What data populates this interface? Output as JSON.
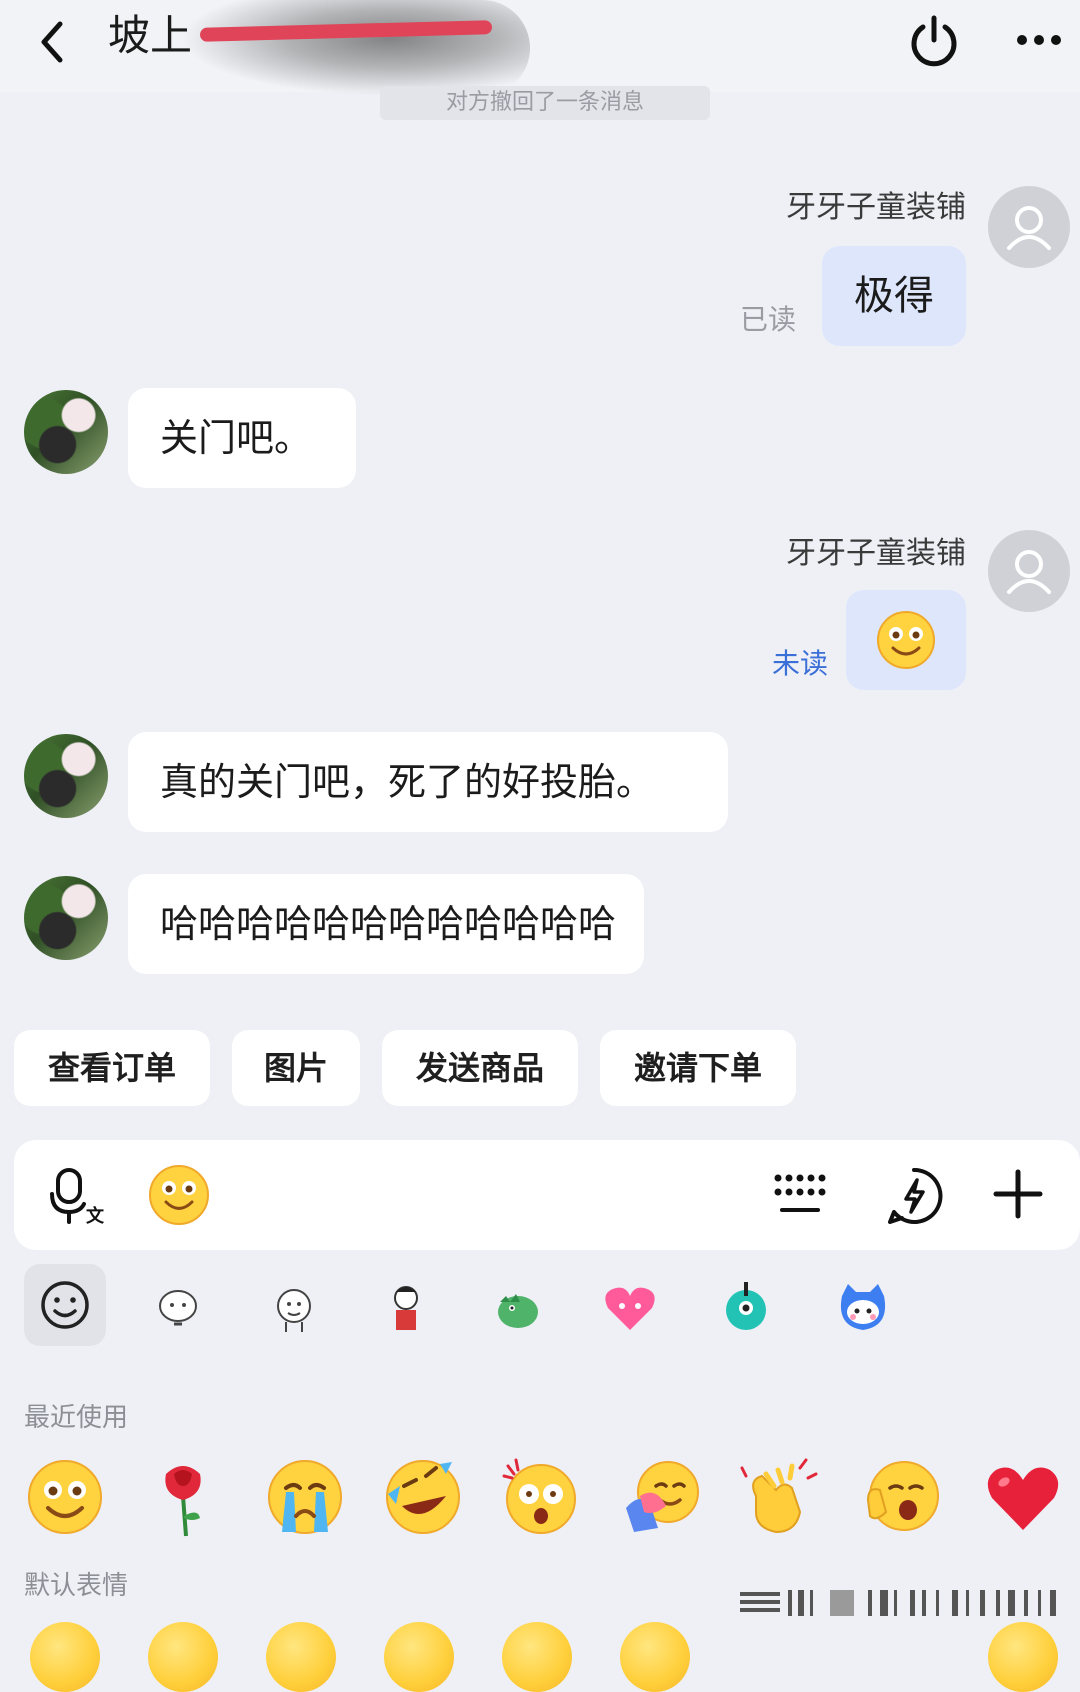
{
  "header": {
    "title": "坡上",
    "banner_text": "对方撤回了一条消息"
  },
  "messages": [
    {
      "sender": "牙牙子童装铺",
      "text": "极得",
      "status": "已读"
    },
    {
      "text": "关门吧。"
    },
    {
      "sender": "牙牙子童装铺",
      "emoji": "smiling-face-emoji",
      "status": "未读"
    },
    {
      "text": "真的关门吧，死了的好投胎。"
    },
    {
      "text": "哈哈哈哈哈哈哈哈哈哈哈哈"
    }
  ],
  "quick_actions": [
    "查看订单",
    "图片",
    "发送商品",
    "邀请下单"
  ],
  "input_bar": {
    "icons": [
      "voice-to-text-icon",
      "emoji-icon",
      "keyboard-icon",
      "quick-reply-icon",
      "plus-icon"
    ]
  },
  "emoji_tabs": [
    "smiley-tab-icon",
    "sticker-pack-1",
    "sticker-pack-2",
    "sticker-pack-3",
    "sticker-pack-4",
    "sticker-pack-5",
    "sticker-pack-6",
    "sticker-pack-7"
  ],
  "emoji_panel": {
    "recent_label": "最近使用",
    "default_label": "默认表情",
    "recent": [
      "smiling-face",
      "rose",
      "crying-face",
      "rolling-laughing-face",
      "shocked-face",
      "hugging-face",
      "clapping-hands",
      "yawning-face",
      "red-heart"
    ]
  },
  "colors": {
    "background": "#eef0f6",
    "outgoing_bubble": "#dde6fb",
    "incoming_bubble": "#ffffff",
    "unread_status": "#3b6fd8",
    "read_status": "#9a9ca3"
  }
}
